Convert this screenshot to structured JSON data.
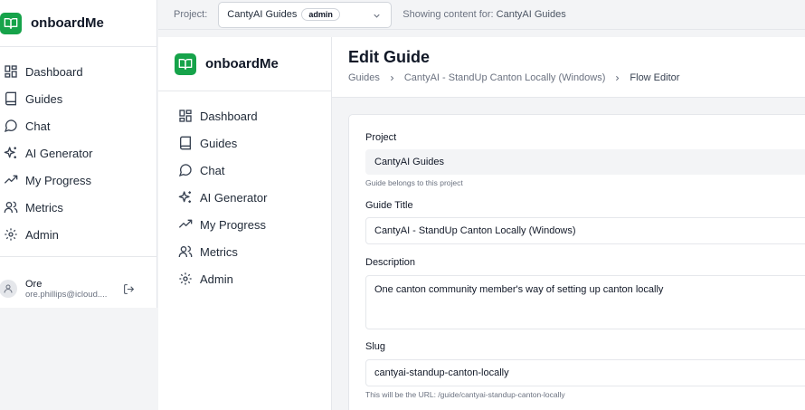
{
  "brand": {
    "name": "onboardMe"
  },
  "nav": {
    "items": [
      {
        "label": "Dashboard",
        "icon": "dashboard-icon"
      },
      {
        "label": "Guides",
        "icon": "book-icon"
      },
      {
        "label": "Chat",
        "icon": "chat-icon"
      },
      {
        "label": "AI Generator",
        "icon": "sparkles-icon"
      },
      {
        "label": "My Progress",
        "icon": "trending-up-icon"
      },
      {
        "label": "Metrics",
        "icon": "users-icon"
      },
      {
        "label": "Admin",
        "icon": "gear-icon"
      }
    ]
  },
  "user": {
    "name": "Ore",
    "email": "ore.phillips@icloud...."
  },
  "topbar": {
    "project_label": "Project:",
    "project_value": "CantyAI Guides",
    "role_badge": "admin",
    "showing_prefix": "Showing content for:",
    "showing_value": "CantyAI Guides"
  },
  "page": {
    "title": "Edit Guide",
    "breadcrumb": [
      "Guides",
      "CantyAI - StandUp Canton Locally (Windows)",
      "Flow Editor"
    ]
  },
  "form": {
    "project": {
      "label": "Project",
      "value": "CantyAI Guides",
      "hint": "Guide belongs to this project"
    },
    "title": {
      "label": "Guide Title",
      "value": "CantyAI - StandUp Canton Locally (Windows)"
    },
    "description": {
      "label": "Description",
      "value": "One canton community member's way of setting up canton locally"
    },
    "slug": {
      "label": "Slug",
      "value": "cantyai-standup-canton-locally",
      "hint": "This will be the URL: /guide/cantyai-standup-canton-locally"
    }
  },
  "colors": {
    "brand": "#16a34a",
    "background": "#f3f4f6",
    "card": "#ffffff"
  }
}
